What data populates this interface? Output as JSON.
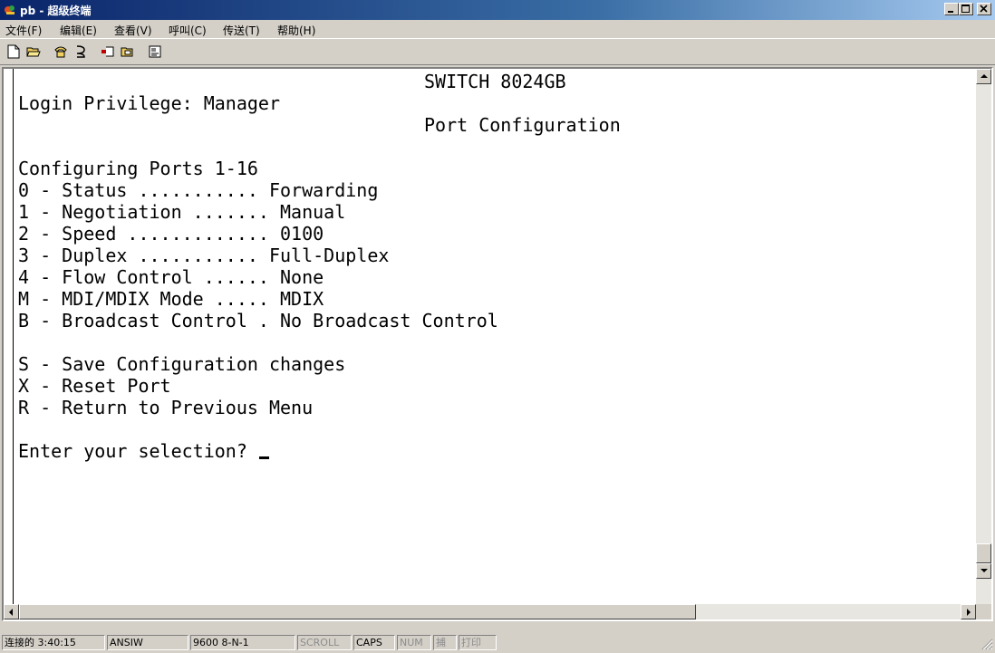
{
  "window": {
    "title": "pb - 超级终端"
  },
  "menu": [
    "文件(F)",
    "编辑(E)",
    "查看(V)",
    "呼叫(C)",
    "传送(T)",
    "帮助(H)"
  ],
  "toolbar": [
    "new-document-icon",
    "open-folder-icon",
    "phone-call-icon",
    "disconnect-icon",
    "send-file-icon",
    "receive-file-icon",
    "properties-icon"
  ],
  "terminal": {
    "header": "SWITCH 8024GB",
    "privilege": "Login Privilege: Manager",
    "screen_title": "Port Configuration",
    "config_heading": "Configuring Ports 1-16",
    "options": [
      "0 - Status ........... Forwarding",
      "1 - Negotiation ....... Manual",
      "2 - Speed ............. 0100",
      "3 - Duplex ........... Full-Duplex",
      "4 - Flow Control ...... None",
      "M - MDI/MDIX Mode ..... MDIX",
      "B - Broadcast Control . No Broadcast Control"
    ],
    "actions": [
      "S - Save Configuration changes",
      "X - Reset Port",
      "R - Return to Previous Menu"
    ],
    "prompt": "Enter your selection? "
  },
  "status": {
    "connected": "连接的 3:40:15",
    "emulation": "ANSIW",
    "port_settings": "9600 8-N-1",
    "scroll": "SCROLL",
    "caps": "CAPS",
    "num": "NUM",
    "capture": "捕",
    "print": "打印"
  }
}
